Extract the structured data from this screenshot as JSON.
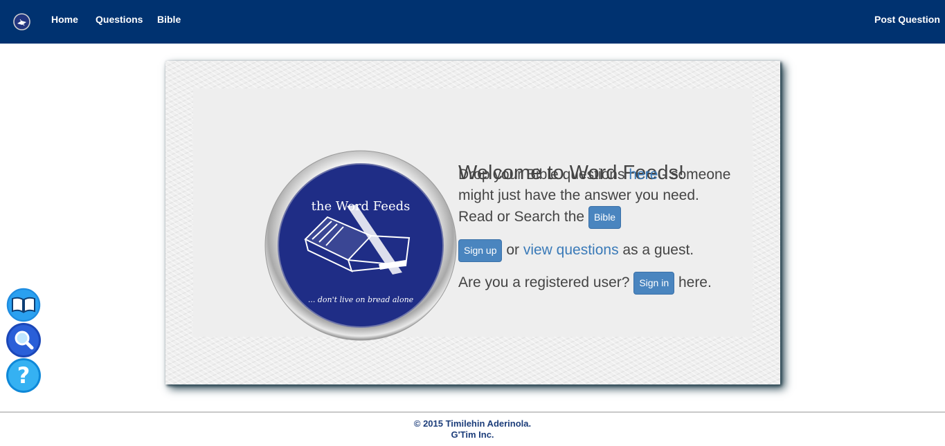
{
  "nav": {
    "items": [
      "Home",
      "Questions",
      "Bible"
    ],
    "right_item": "Post Question"
  },
  "hero": {
    "logo_title": "the Word Feeds",
    "logo_tagline": "... don't live on bread alone",
    "welcome": "Welcome to Word Feeds!",
    "line1_pre": "Drop your Bible questions ",
    "line1_link": "here",
    "line1_post": " - someone",
    "line2": "might just have the answer you need.",
    "line3_pre": "Read or Search the ",
    "bible_button": "Bible",
    "signup_button": "Sign up",
    "line4_mid": " or ",
    "line4_link": "view questions",
    "line4_post": " as a guest.",
    "line5_pre": "Are you a registered user? ",
    "signin_button": "Sign in",
    "line5_post": " here."
  },
  "footer": {
    "copyright": "© 2015 Timilehin Aderinola.",
    "company": "G'Tim Inc."
  },
  "colors": {
    "navbar": "#003270",
    "button": "#4a85bf",
    "link": "#3a7ab8",
    "logo_blue": "#1f2d86"
  }
}
